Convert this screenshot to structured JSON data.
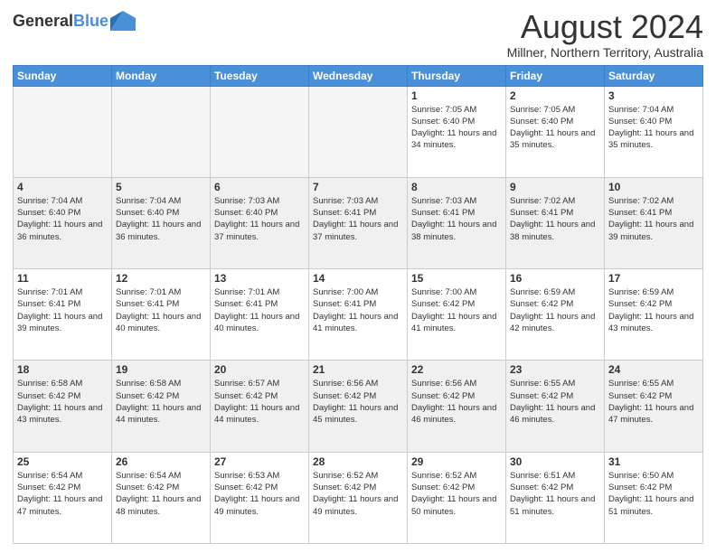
{
  "header": {
    "logo_line1": "General",
    "logo_line2": "Blue",
    "title": "August 2024",
    "subtitle": "Millner, Northern Territory, Australia"
  },
  "weekdays": [
    "Sunday",
    "Monday",
    "Tuesday",
    "Wednesday",
    "Thursday",
    "Friday",
    "Saturday"
  ],
  "weeks": [
    [
      {
        "day": "",
        "empty": true
      },
      {
        "day": "",
        "empty": true
      },
      {
        "day": "",
        "empty": true
      },
      {
        "day": "",
        "empty": true
      },
      {
        "day": "1",
        "sunrise": "7:05 AM",
        "sunset": "6:40 PM",
        "daylight": "11 hours and 34 minutes."
      },
      {
        "day": "2",
        "sunrise": "7:05 AM",
        "sunset": "6:40 PM",
        "daylight": "11 hours and 35 minutes."
      },
      {
        "day": "3",
        "sunrise": "7:04 AM",
        "sunset": "6:40 PM",
        "daylight": "11 hours and 35 minutes."
      }
    ],
    [
      {
        "day": "4",
        "sunrise": "7:04 AM",
        "sunset": "6:40 PM",
        "daylight": "11 hours and 36 minutes."
      },
      {
        "day": "5",
        "sunrise": "7:04 AM",
        "sunset": "6:40 PM",
        "daylight": "11 hours and 36 minutes."
      },
      {
        "day": "6",
        "sunrise": "7:03 AM",
        "sunset": "6:40 PM",
        "daylight": "11 hours and 37 minutes."
      },
      {
        "day": "7",
        "sunrise": "7:03 AM",
        "sunset": "6:41 PM",
        "daylight": "11 hours and 37 minutes."
      },
      {
        "day": "8",
        "sunrise": "7:03 AM",
        "sunset": "6:41 PM",
        "daylight": "11 hours and 38 minutes."
      },
      {
        "day": "9",
        "sunrise": "7:02 AM",
        "sunset": "6:41 PM",
        "daylight": "11 hours and 38 minutes."
      },
      {
        "day": "10",
        "sunrise": "7:02 AM",
        "sunset": "6:41 PM",
        "daylight": "11 hours and 39 minutes."
      }
    ],
    [
      {
        "day": "11",
        "sunrise": "7:01 AM",
        "sunset": "6:41 PM",
        "daylight": "11 hours and 39 minutes."
      },
      {
        "day": "12",
        "sunrise": "7:01 AM",
        "sunset": "6:41 PM",
        "daylight": "11 hours and 40 minutes."
      },
      {
        "day": "13",
        "sunrise": "7:01 AM",
        "sunset": "6:41 PM",
        "daylight": "11 hours and 40 minutes."
      },
      {
        "day": "14",
        "sunrise": "7:00 AM",
        "sunset": "6:41 PM",
        "daylight": "11 hours and 41 minutes."
      },
      {
        "day": "15",
        "sunrise": "7:00 AM",
        "sunset": "6:42 PM",
        "daylight": "11 hours and 41 minutes."
      },
      {
        "day": "16",
        "sunrise": "6:59 AM",
        "sunset": "6:42 PM",
        "daylight": "11 hours and 42 minutes."
      },
      {
        "day": "17",
        "sunrise": "6:59 AM",
        "sunset": "6:42 PM",
        "daylight": "11 hours and 43 minutes."
      }
    ],
    [
      {
        "day": "18",
        "sunrise": "6:58 AM",
        "sunset": "6:42 PM",
        "daylight": "11 hours and 43 minutes."
      },
      {
        "day": "19",
        "sunrise": "6:58 AM",
        "sunset": "6:42 PM",
        "daylight": "11 hours and 44 minutes."
      },
      {
        "day": "20",
        "sunrise": "6:57 AM",
        "sunset": "6:42 PM",
        "daylight": "11 hours and 44 minutes."
      },
      {
        "day": "21",
        "sunrise": "6:56 AM",
        "sunset": "6:42 PM",
        "daylight": "11 hours and 45 minutes."
      },
      {
        "day": "22",
        "sunrise": "6:56 AM",
        "sunset": "6:42 PM",
        "daylight": "11 hours and 46 minutes."
      },
      {
        "day": "23",
        "sunrise": "6:55 AM",
        "sunset": "6:42 PM",
        "daylight": "11 hours and 46 minutes."
      },
      {
        "day": "24",
        "sunrise": "6:55 AM",
        "sunset": "6:42 PM",
        "daylight": "11 hours and 47 minutes."
      }
    ],
    [
      {
        "day": "25",
        "sunrise": "6:54 AM",
        "sunset": "6:42 PM",
        "daylight": "11 hours and 47 minutes."
      },
      {
        "day": "26",
        "sunrise": "6:54 AM",
        "sunset": "6:42 PM",
        "daylight": "11 hours and 48 minutes."
      },
      {
        "day": "27",
        "sunrise": "6:53 AM",
        "sunset": "6:42 PM",
        "daylight": "11 hours and 49 minutes."
      },
      {
        "day": "28",
        "sunrise": "6:52 AM",
        "sunset": "6:42 PM",
        "daylight": "11 hours and 49 minutes."
      },
      {
        "day": "29",
        "sunrise": "6:52 AM",
        "sunset": "6:42 PM",
        "daylight": "11 hours and 50 minutes."
      },
      {
        "day": "30",
        "sunrise": "6:51 AM",
        "sunset": "6:42 PM",
        "daylight": "11 hours and 51 minutes."
      },
      {
        "day": "31",
        "sunrise": "6:50 AM",
        "sunset": "6:42 PM",
        "daylight": "11 hours and 51 minutes."
      }
    ]
  ]
}
